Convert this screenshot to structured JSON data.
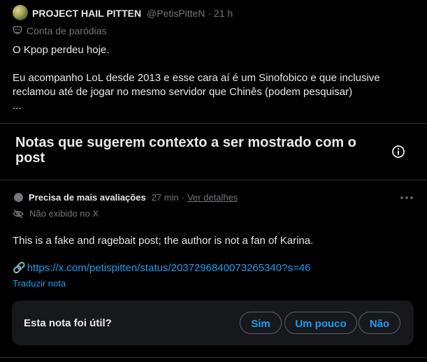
{
  "post": {
    "author_name": "PROJECT HAIL PITTEN",
    "author_handle": "@PetisPitteN",
    "timestamp": "21 h",
    "parody_label": "Conta de paródias",
    "text_line1": "O Kpop perdeu hoje.",
    "text_line2": "Eu acompanho LoL desde 2013 e esse cara aí é um Sinofobico e que inclusive reclamou até de jogar no mesmo servidor que Chinês (podem pesquisar)",
    "text_line3": "..."
  },
  "notes": {
    "title": "Notas que sugerem contexto a ser mostrado com o post",
    "info_icon": "info-icon"
  },
  "note": {
    "status": "Precisa de mais avaliações",
    "time": "27 min",
    "separator": "·",
    "details_link": "Ver detalhes",
    "not_shown": "Não exibido no X",
    "body": "This is a fake and ragebait post; the author is not a fan of Karina.",
    "link_prefix": "🔗",
    "link": "https://x.com/petispitten/status/2037296840073265340?s=46",
    "translate": "Traduzir nota"
  },
  "helpful": {
    "question": "Esta nota foi útil?",
    "yes": "Sim",
    "somewhat": "Um pouco",
    "no": "Não"
  },
  "colors": {
    "background": "#000000",
    "text": "#e7e9ea",
    "muted": "#71767b",
    "accent": "#1d9bf0",
    "panel": "#16181c",
    "border": "#2f3336"
  }
}
